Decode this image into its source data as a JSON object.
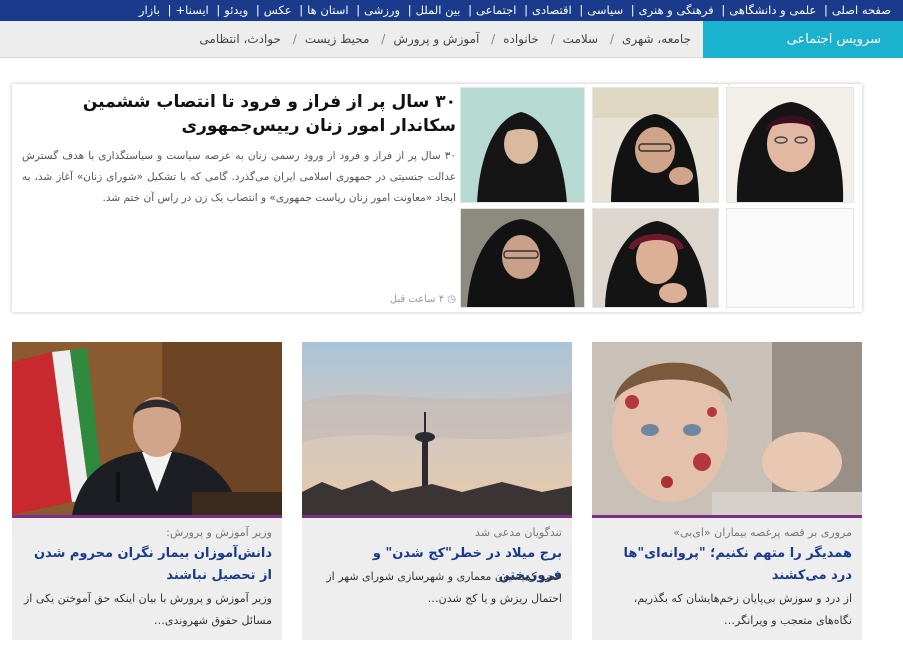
{
  "top_nav": {
    "items": [
      "صفحه اصلی",
      "علمی و دانشگاهی",
      "فرهنگی و هنری",
      "سیاسی",
      "اقتصادی",
      "اجتماعی",
      "بین الملل",
      "ورزشی",
      "استان ها",
      "عکس",
      "ویدئو",
      "ایسنا+",
      "بازار"
    ]
  },
  "sub_bar": {
    "title": "سرویس اجتماعی",
    "items": [
      "جامعه، شهری",
      "سلامت",
      "خانواده",
      "آموزش و پرورش",
      "محیط زیست",
      "حوادث، انتظامی"
    ]
  },
  "featured": {
    "headline": "۳۰ سال پر از فراز و فرود تا انتصاب ششمین سکاندار امور زنان رییس‌جمهوری",
    "summary": "۳۰ سال پر از فراز و فرود از ورود رسمی زنان به عرصه سیاست و سیاستگذاری با هدف گسترش عدالت جنسیتی در جمهوری اسلامی ایران می‌گذرد. گامی که با تشکیل «شورای زنان» آغاز شد، به ایجاد «معاونت امور زنان ریاست جمهوری» و انتصاب یک زن در راس آن ختم شد.",
    "time": "۴ ساعت قبل"
  },
  "cards": [
    {
      "kicker": "مروری بر قصه پرغصه بیماران «ای‌بی»",
      "title": "همدیگر را متهم نکنیم؛ \"پروانه‌ای\"ها درد می‌کشند",
      "lead": "از درد و سوزش بی‌پایان زخم‌هایشان که بگذریم، نگاه‌های متعجب و ویرانگر…"
    },
    {
      "kicker": "تندگویان مدعی شد",
      "title": "برج میلاد در خطر\"کج شدن\" و فروریختن",
      "lead": "عضو کمیسیون معماری و شهرسازی شورای شهر از احتمال ریزش و یا کج شدن…"
    },
    {
      "kicker": "وزیر آموزش و پرورش:",
      "title": "دانش‌آموزان بیمار نگران محروم شدن از تحصیل نباشند",
      "lead": "وزیر آموزش و پرورش با بیان اینکه حق آموختن یکی از مسائل حقوق شهروندی…"
    }
  ]
}
